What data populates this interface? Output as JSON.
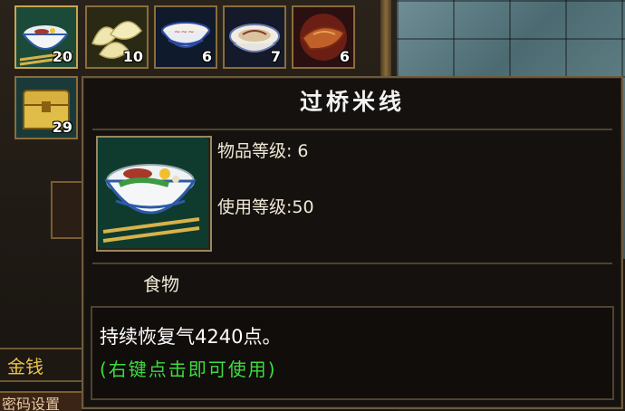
{
  "inventory": {
    "slots": [
      {
        "name": "noodle-bowl",
        "count": "20"
      },
      {
        "name": "dumplings",
        "count": "10"
      },
      {
        "name": "blue-porcelain-bowl",
        "count": "6"
      },
      {
        "name": "soup-bowl",
        "count": "7"
      },
      {
        "name": "roasted-meat",
        "count": "6"
      },
      {
        "name": "treasure-chest",
        "count": "29"
      }
    ],
    "gold_label": "金钱",
    "bottom_label": "密码设置"
  },
  "tooltip": {
    "title": "过桥米线",
    "item_level_label": "物品等级:",
    "item_level_value": "6",
    "use_level_label": "使用等级:",
    "use_level_value": "50",
    "type": "食物",
    "desc_line1": "持续恢复气4240点。",
    "desc_line2": "(右键点击即可使用)"
  },
  "colors": {
    "title": "#f2f2f2",
    "hint_green": "#3edb3e",
    "gold_text": "#e8c14a",
    "slot_border": "#8a6d3b"
  }
}
